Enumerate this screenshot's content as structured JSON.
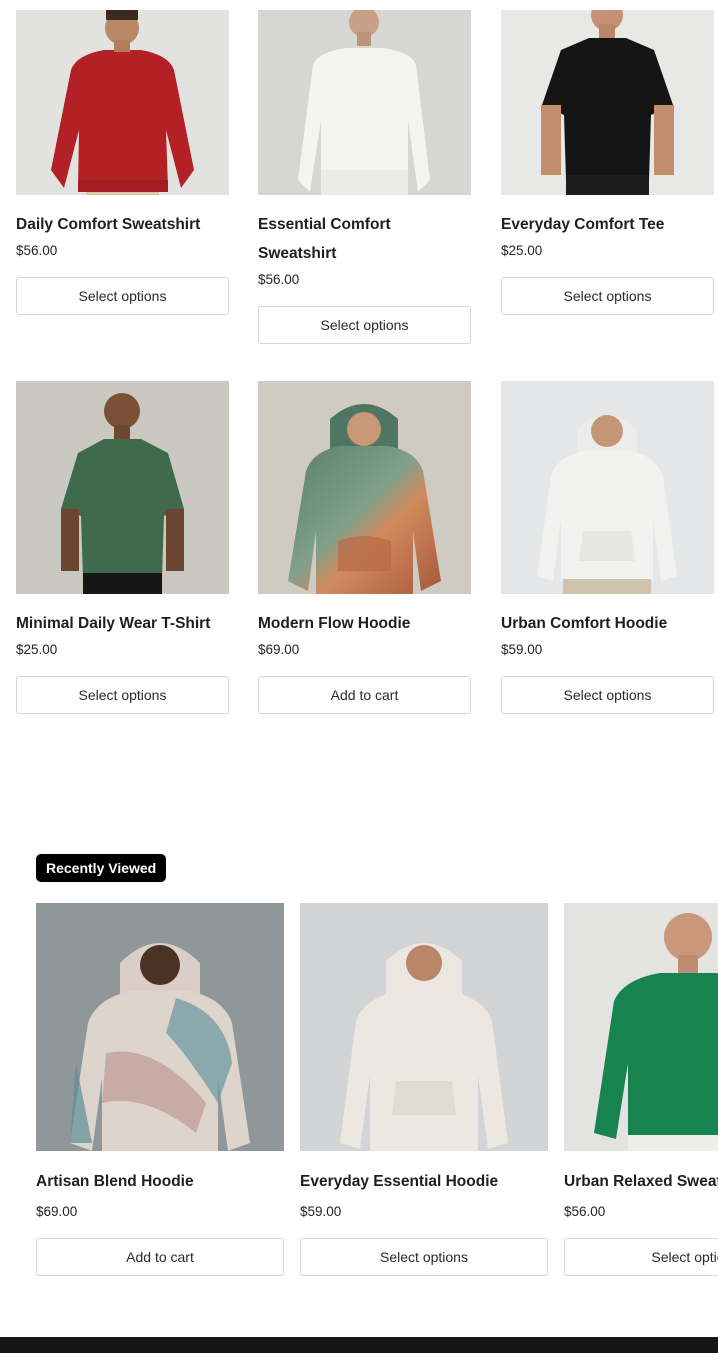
{
  "products": [
    {
      "title": "Daily Comfort Sweatshirt",
      "price": "$56.00",
      "button": "Select options",
      "image": "red-sweatshirt-photo"
    },
    {
      "title": "Essential Comfort Sweatshirt",
      "price": "$56.00",
      "button": "Select options",
      "image": "white-sweatshirt-photo"
    },
    {
      "title": "Everyday Comfort Tee",
      "price": "$25.00",
      "button": "Select options",
      "image": "black-tee-photo"
    },
    {
      "title": "Minimal Daily Wear T-Shirt",
      "price": "$25.00",
      "button": "Select options",
      "image": "green-tshirt-photo"
    },
    {
      "title": "Modern Flow Hoodie",
      "price": "$69.00",
      "button": "Add to cart",
      "image": "green-orange-hoodie-photo"
    },
    {
      "title": "Urban Comfort Hoodie",
      "price": "$59.00",
      "button": "Select options",
      "image": "white-hoodie-photo"
    }
  ],
  "recently_viewed": {
    "label": "Recently Viewed",
    "items": [
      {
        "title": "Artisan Blend Hoodie",
        "price": "$69.00",
        "button": "Add to cart",
        "image": "beige-art-hoodie-photo"
      },
      {
        "title": "Everyday Essential Hoodie",
        "price": "$59.00",
        "button": "Select options",
        "image": "cream-hoodie-photo"
      },
      {
        "title": "Urban Relaxed Sweat",
        "price": "$56.00",
        "button": "Select optio",
        "image": "green-sweatshirt-photo"
      }
    ]
  },
  "colors": {
    "badge_bg": "#000000",
    "button_border": "#d6d6d6",
    "footer": "#161616"
  }
}
